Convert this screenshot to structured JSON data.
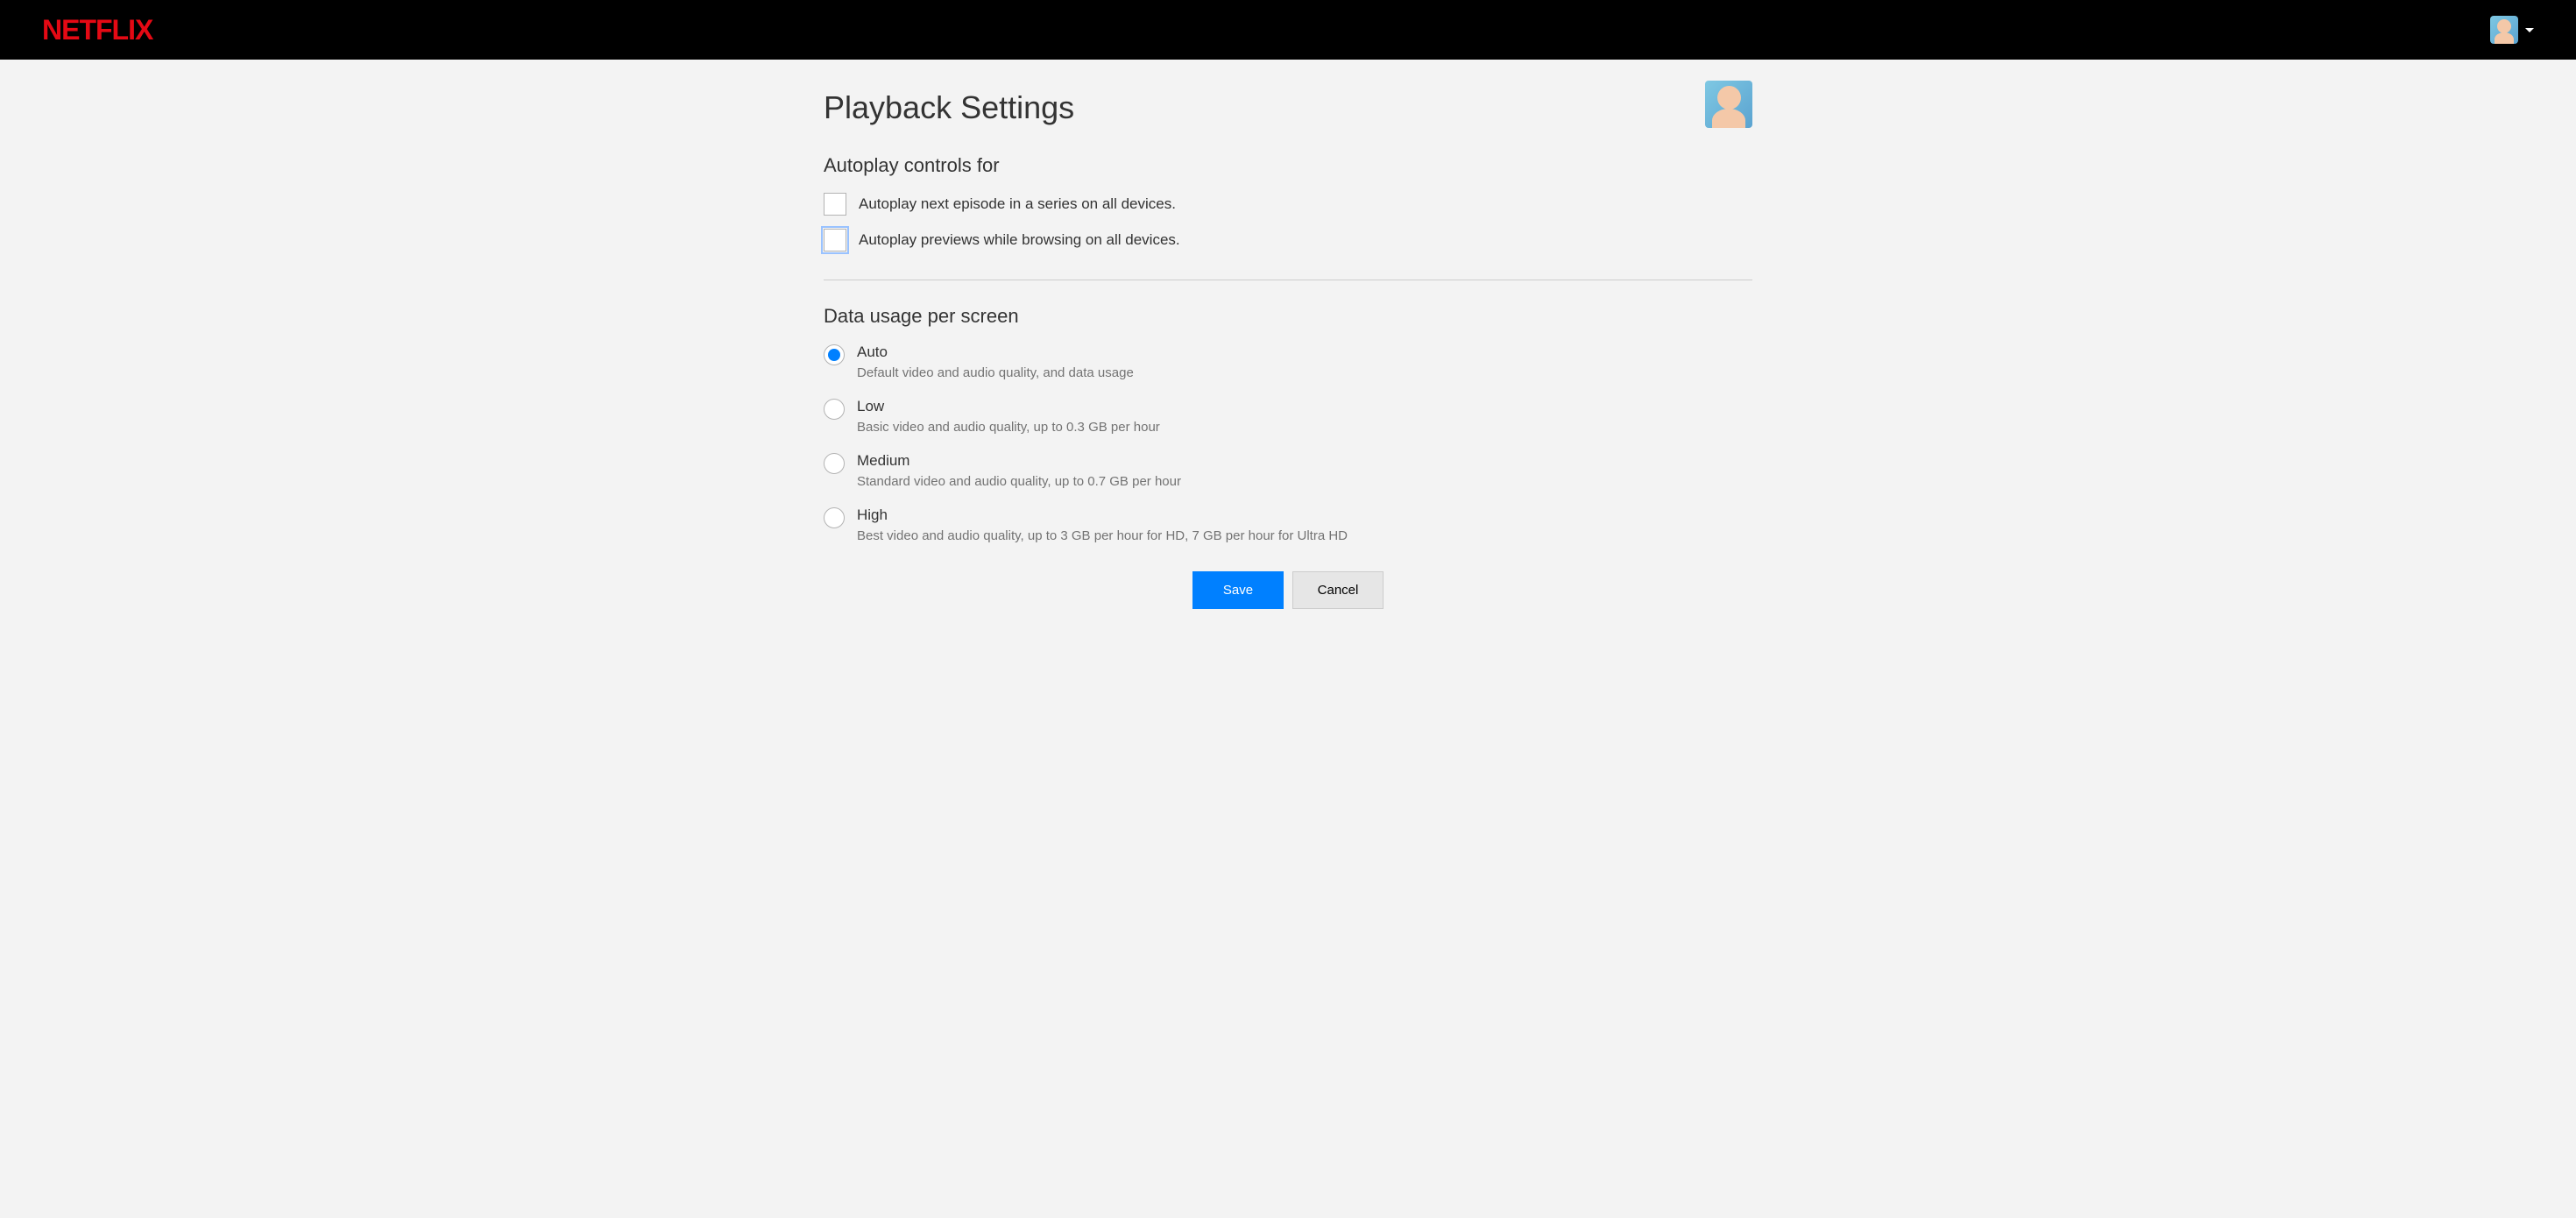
{
  "header": {
    "logo_text": "NETFLIX"
  },
  "page": {
    "title": "Playback Settings"
  },
  "autoplay": {
    "section_title": "Autoplay controls for",
    "options": [
      {
        "label": "Autoplay next episode in a series on all devices.",
        "checked": false,
        "focused": false
      },
      {
        "label": "Autoplay previews while browsing on all devices.",
        "checked": false,
        "focused": true
      }
    ]
  },
  "data_usage": {
    "section_title": "Data usage per screen",
    "options": [
      {
        "label": "Auto",
        "desc": "Default video and audio quality, and data usage",
        "checked": true
      },
      {
        "label": "Low",
        "desc": "Basic video and audio quality, up to 0.3 GB per hour",
        "checked": false
      },
      {
        "label": "Medium",
        "desc": "Standard video and audio quality, up to 0.7 GB per hour",
        "checked": false
      },
      {
        "label": "High",
        "desc": "Best video and audio quality, up to 3 GB per hour for HD, 7 GB per hour for Ultra HD",
        "checked": false
      }
    ]
  },
  "buttons": {
    "save": "Save",
    "cancel": "Cancel"
  }
}
